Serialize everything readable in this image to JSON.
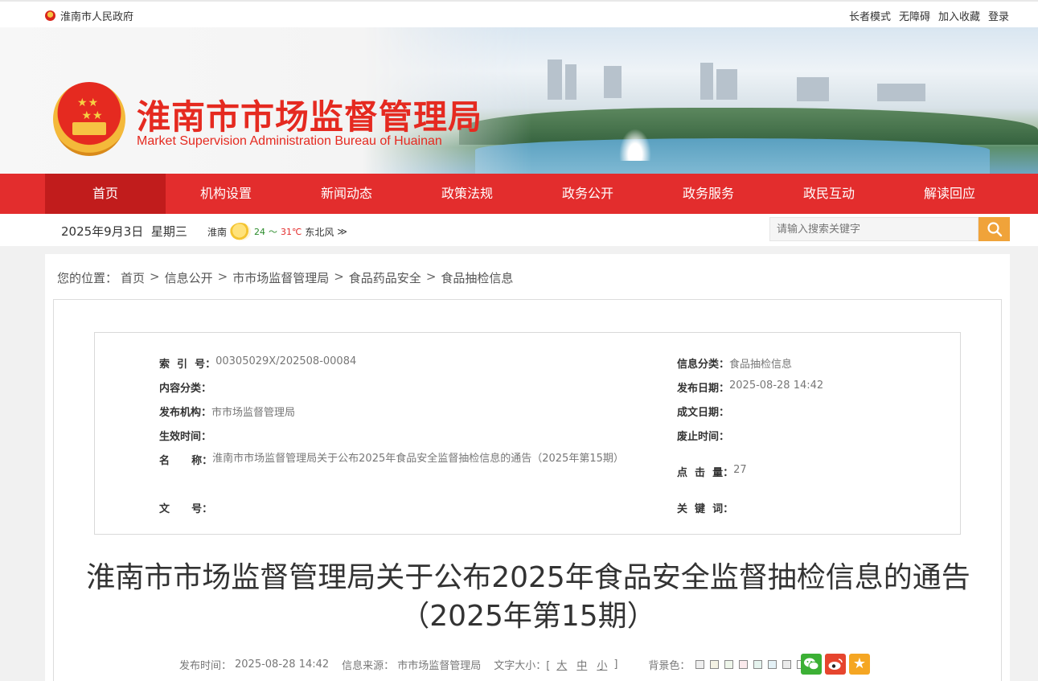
{
  "top_bar": {
    "site_name": "淮南市人民政府",
    "links": [
      "长者模式",
      "无障碍",
      "加入收藏",
      "登录"
    ]
  },
  "banner": {
    "title_cn": "淮南市市场监督管理局",
    "title_en": "Market Supervision Administration Bureau of Huainan"
  },
  "nav": {
    "items": [
      "首页",
      "机构设置",
      "新闻动态",
      "政策法规",
      "政务公开",
      "政务服务",
      "政民互动",
      "解读回应"
    ],
    "active": "首页"
  },
  "date_row": {
    "date": "2025年9月3日",
    "weekday": "星期三",
    "city": "淮南",
    "temp_low": "24",
    "temp_sep": "～",
    "temp_high": "31℃",
    "wind": "东北风",
    "more": "≫",
    "search_placeholder": "请输入搜索关键字"
  },
  "breadcrumb": {
    "prefix": "您的位置：",
    "items": [
      "首页",
      "信息公开",
      "市市场监督管理局",
      "食品药品安全",
      "食品抽检信息"
    ],
    "separator": ">"
  },
  "meta": {
    "index_no_label": "索  引  号：",
    "index_no": "00305029X/202508-00084",
    "category_label": "信息分类：",
    "category": "食品抽检信息",
    "content_type_label": "内容分类：",
    "content_type": "",
    "publish_date_label": "发布日期：",
    "publish_date": "2025-08-28 14:42",
    "agency_label": "发布机构：",
    "agency": "市市场监督管理局",
    "written_date_label": "成文日期：",
    "written_date": "",
    "effective_label": "生效时间：",
    "effective": "",
    "expire_label": "废止时间：",
    "expire": "",
    "name_label": "名      称：",
    "name": "淮南市市场监督管理局关于公布2025年食品安全监督抽检信息的通告（2025年第15期）",
    "clicks_label": "点  击  量：",
    "clicks": "27",
    "doc_no_label": "文      号：",
    "doc_no": "",
    "keywords_label": "关  键  词：",
    "keywords": ""
  },
  "article": {
    "title": "淮南市市场监督管理局关于公布2025年食品安全监督抽检信息的通告（2025年第15期）",
    "publish_time_label": "发布时间：",
    "publish_time": "2025-08-28 14:42",
    "source_label": "信息来源：",
    "source": "市市场监督管理局",
    "font_size_label": "文字大小：[",
    "font_sizes": [
      "大",
      "中",
      "小"
    ],
    "font_size_close": "]",
    "bg_label": "背景色：",
    "bg_colors": [
      "#eeeeee",
      "#f4f2e4",
      "#eef6ea",
      "#fbe9ec",
      "#e5f3ee",
      "#e4f1f6",
      "#eaeaea",
      "#ffffff"
    ]
  },
  "share": {
    "wechat_color": "#3cb035",
    "weibo_color": "#e6452e",
    "favorite_color": "#f5a623"
  }
}
